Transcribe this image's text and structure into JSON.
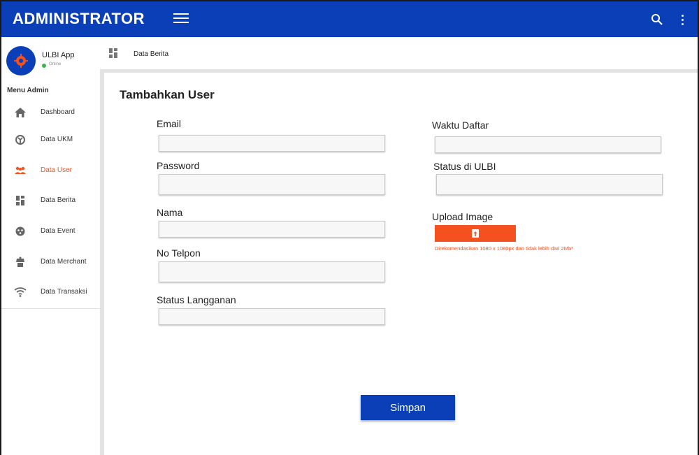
{
  "header": {
    "title": "ADMINISTRATOR"
  },
  "profile": {
    "app_name": "ULBI App",
    "status": "Online",
    "status_color": "#3bb54a"
  },
  "sidebar": {
    "heading": "Menu Admin",
    "items": [
      {
        "label": "Dashboard",
        "icon": "home-icon",
        "active": false
      },
      {
        "label": "Data UKM",
        "icon": "ukm-icon",
        "active": false
      },
      {
        "label": "Data User",
        "icon": "users-icon",
        "active": true
      },
      {
        "label": "Data Berita",
        "icon": "dashboard-grid-icon",
        "active": false
      },
      {
        "label": "Data Event",
        "icon": "event-icon",
        "active": false
      },
      {
        "label": "Data Merchant",
        "icon": "merchant-icon",
        "active": false
      },
      {
        "label": "Data Transaksi",
        "icon": "wifi-icon",
        "active": false
      }
    ]
  },
  "breadcrumb": {
    "label": "Data Berita"
  },
  "form": {
    "title": "Tambahkan User",
    "fields": {
      "email": {
        "label": "Email",
        "value": ""
      },
      "password": {
        "label": "Password",
        "value": ""
      },
      "nama": {
        "label": "Nama",
        "value": ""
      },
      "no_telpon": {
        "label": "No Telpon",
        "value": ""
      },
      "status_langganan": {
        "label": "Status Langganan",
        "value": ""
      },
      "waktu_daftar": {
        "label": "Waktu Daftar",
        "value": ""
      },
      "status_ulbi": {
        "label": "Status di ULBI",
        "value": ""
      }
    },
    "upload": {
      "label": "Upload Image",
      "note": "Direkomendasikan 1080 x 1080px dan tidak lebih dari 2Mb*"
    },
    "submit_label": "Simpan"
  },
  "colors": {
    "primary": "#0a3fb7",
    "accent": "#f4511e"
  }
}
